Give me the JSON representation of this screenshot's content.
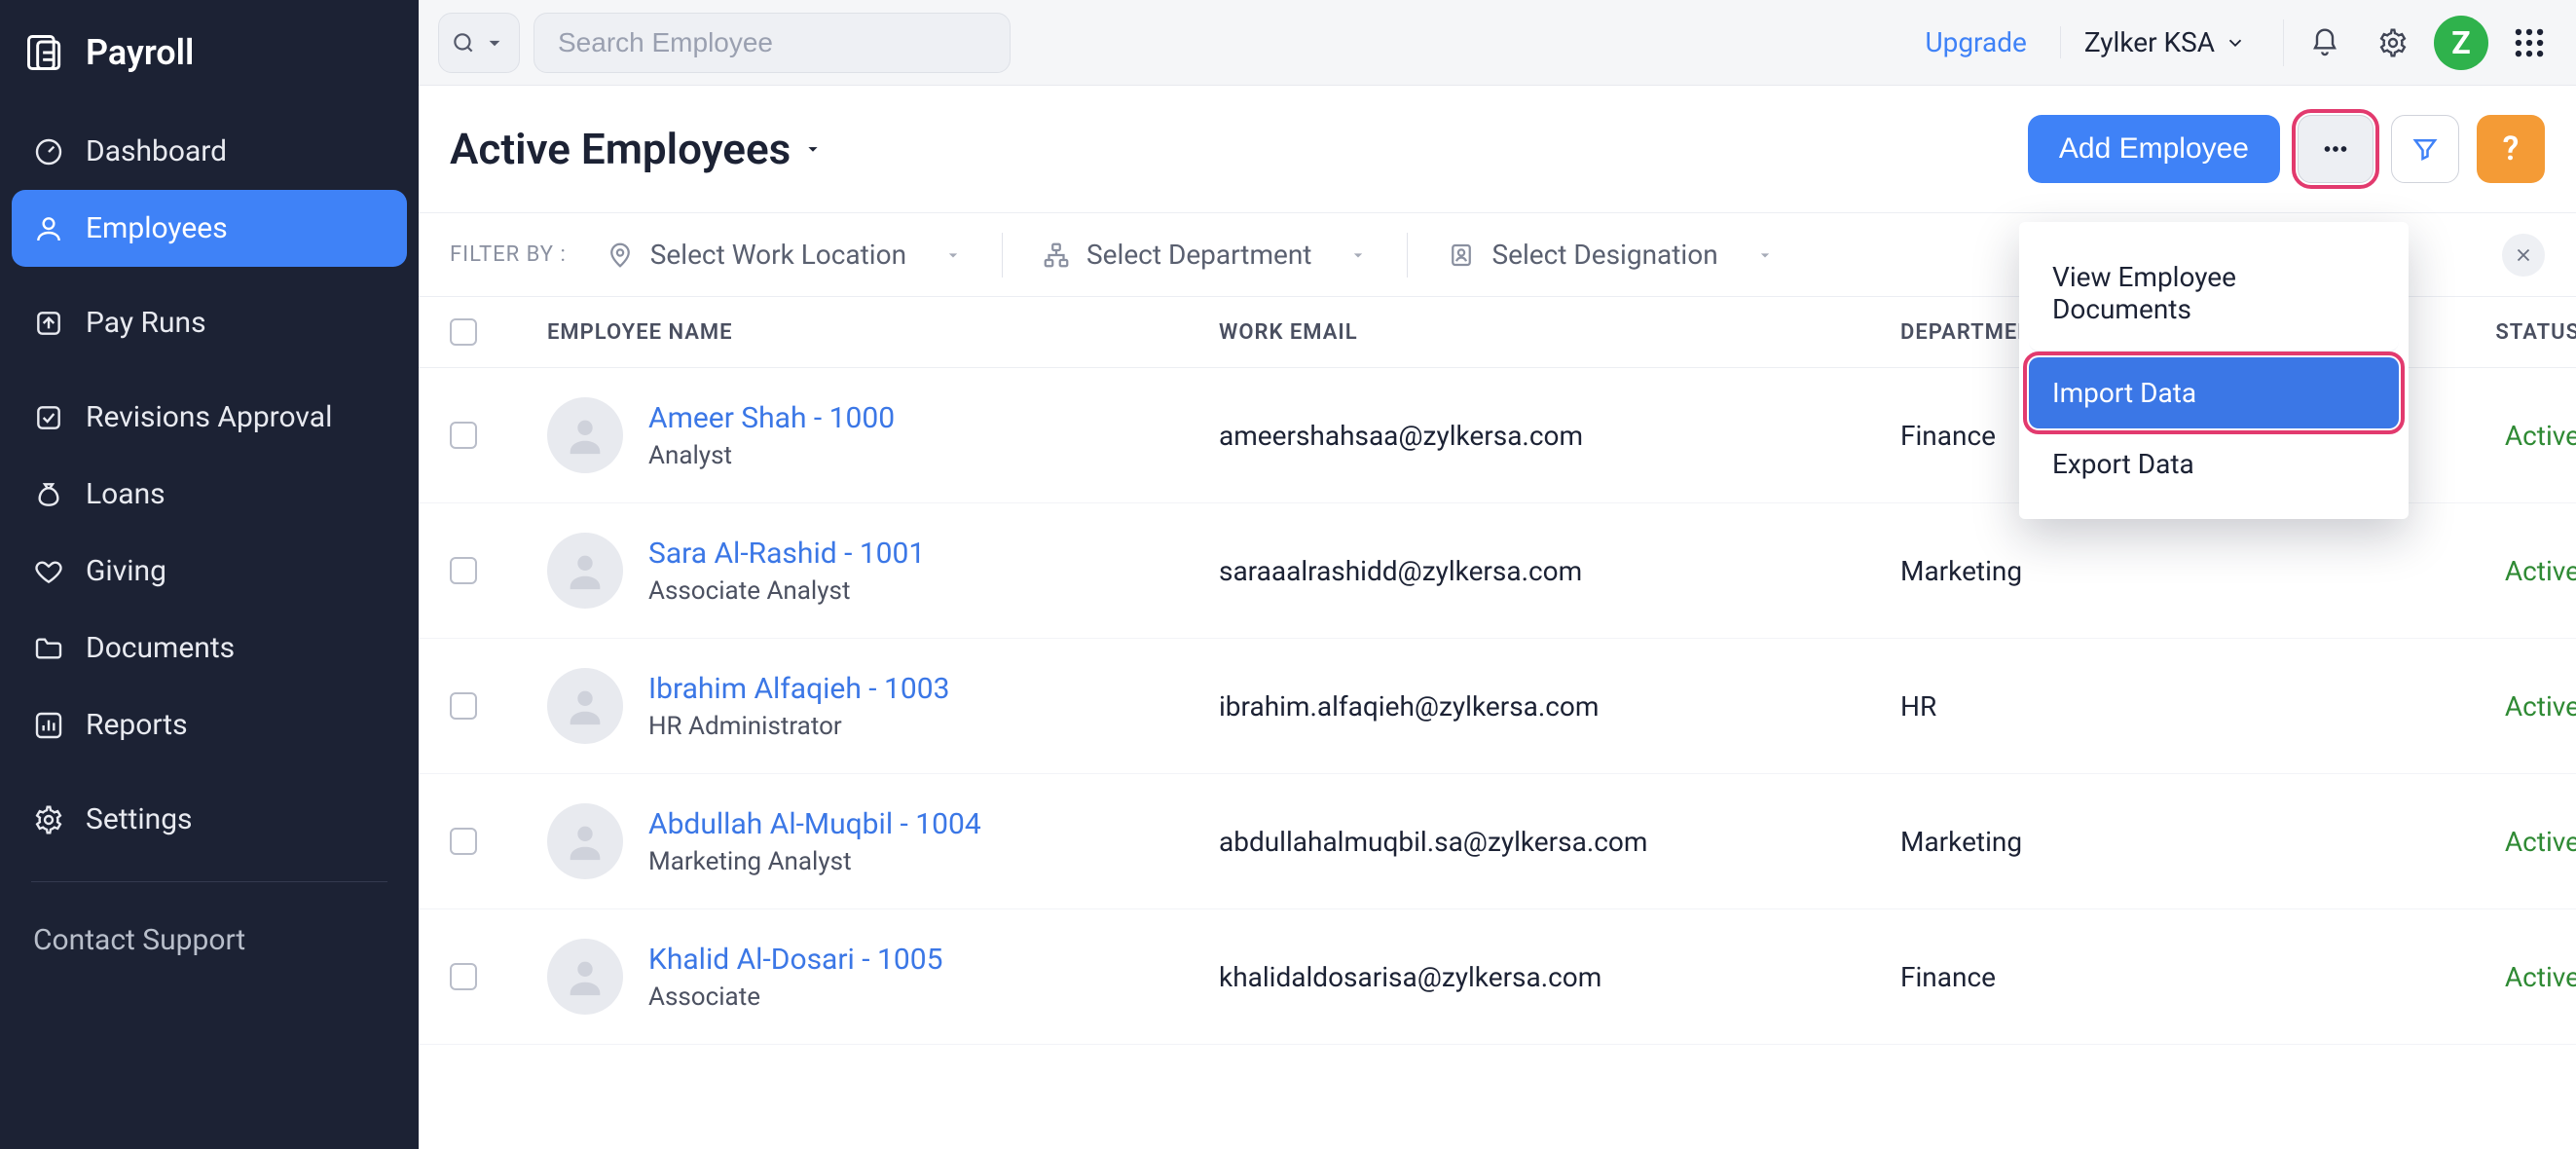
{
  "app": {
    "name": "Payroll"
  },
  "topbar": {
    "search_placeholder": "Search Employee",
    "upgrade_label": "Upgrade",
    "org_name": "Zylker KSA",
    "avatar_initial": "Z"
  },
  "sidebar": {
    "items": [
      {
        "label": "Dashboard",
        "icon": "gauge-icon"
      },
      {
        "label": "Employees",
        "icon": "user-icon",
        "active": true
      },
      {
        "label": "Pay Runs",
        "icon": "arrow-out-icon"
      },
      {
        "label": "Revisions Approval",
        "icon": "check-square-icon"
      },
      {
        "label": "Loans",
        "icon": "moneybag-icon"
      },
      {
        "label": "Giving",
        "icon": "heart-icon"
      },
      {
        "label": "Documents",
        "icon": "folder-icon"
      },
      {
        "label": "Reports",
        "icon": "bar-chart-icon"
      },
      {
        "label": "Settings",
        "icon": "gear-icon"
      }
    ],
    "contact_label": "Contact Support"
  },
  "page": {
    "title": "Active Employees",
    "add_button": "Add Employee",
    "help_label": "?",
    "menu": {
      "items": [
        {
          "label": "View Employee Documents"
        },
        {
          "label": "Import Data",
          "selected": true
        },
        {
          "label": "Export Data"
        }
      ]
    }
  },
  "filters": {
    "label": "FILTER BY :",
    "work_location": "Select Work Location",
    "department": "Select Department",
    "designation": "Select Designation"
  },
  "table": {
    "columns": {
      "name": "EMPLOYEE NAME",
      "email": "WORK EMAIL",
      "department": "DEPARTMENT",
      "status": "STATUS"
    },
    "rows": [
      {
        "name": "Ameer Shah - 1000",
        "role": "Analyst",
        "email": "ameershahsaa@zylkersa.com",
        "department": "Finance",
        "status": "Active"
      },
      {
        "name": "Sara Al-Rashid - 1001",
        "role": "Associate Analyst",
        "email": "saraaalrashidd@zylkersa.com",
        "department": "Marketing",
        "status": "Active"
      },
      {
        "name": "Ibrahim Alfaqieh - 1003",
        "role": "HR Administrator",
        "email": "ibrahim.alfaqieh@zylkersa.com",
        "department": "HR",
        "status": "Active"
      },
      {
        "name": "Abdullah Al-Muqbil - 1004",
        "role": "Marketing Analyst",
        "email": "abdullahalmuqbil.sa@zylkersa.com",
        "department": "Marketing",
        "status": "Active"
      },
      {
        "name": "Khalid Al-Dosari - 1005",
        "role": "Associate",
        "email": "khalidaldosarisa@zylkersa.com",
        "department": "Finance",
        "status": "Active"
      }
    ]
  }
}
